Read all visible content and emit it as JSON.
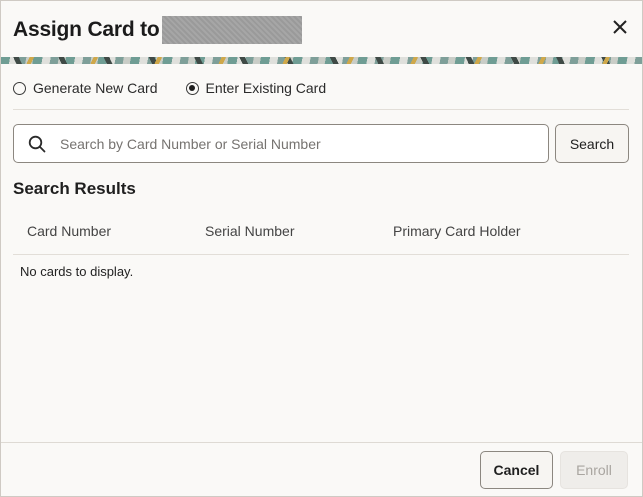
{
  "dialog": {
    "title": "Assign Card to",
    "close_icon": "close-icon"
  },
  "options": {
    "items": [
      {
        "label": "Generate New Card",
        "selected": false
      },
      {
        "label": "Enter Existing Card",
        "selected": true
      }
    ]
  },
  "search": {
    "placeholder": "Search by Card Number or Serial Number",
    "value": "",
    "icon": "search-icon",
    "button_label": "Search"
  },
  "results": {
    "title": "Search Results",
    "columns": [
      "Card Number",
      "Serial Number",
      "Primary Card Holder"
    ],
    "rows": [],
    "empty_message": "No cards to display."
  },
  "footer": {
    "cancel_label": "Cancel",
    "enroll_label": "Enroll"
  }
}
